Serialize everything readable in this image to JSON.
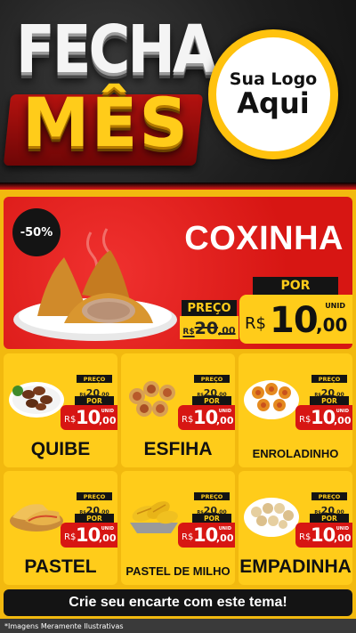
{
  "header": {
    "title_line1": "FECHA",
    "title_line2": "MÊS",
    "logo_line1": "Sua Logo",
    "logo_line2": "Aqui"
  },
  "featured": {
    "discount": "-50%",
    "name": "COXINHA",
    "preco_label": "PREÇO",
    "old_currency": "R$",
    "old_int": "20",
    "old_dec": ",00",
    "por_label": "POR",
    "new_currency": "R$",
    "new_int": "10",
    "new_dec": ",00",
    "unit": "UNID"
  },
  "labels": {
    "preco": "PREÇO",
    "por": "POR",
    "currency": "R$",
    "unit": "UNID"
  },
  "products": [
    {
      "name": "QUIBE",
      "old_int": "20",
      "old_dec": ",00",
      "new_int": "10",
      "new_dec": ",00"
    },
    {
      "name": "ESFIHA",
      "old_int": "20",
      "old_dec": ",00",
      "new_int": "10",
      "new_dec": ",00"
    },
    {
      "name": "ENROLADINHO",
      "old_int": "20",
      "old_dec": ",00",
      "new_int": "10",
      "new_dec": ",00"
    },
    {
      "name": "PASTEL",
      "old_int": "20",
      "old_dec": ",00",
      "new_int": "10",
      "new_dec": ",00"
    },
    {
      "name": "PASTEL DE MILHO",
      "old_int": "20",
      "old_dec": ",00",
      "new_int": "10",
      "new_dec": ",00"
    },
    {
      "name": "EMPADINHA",
      "old_int": "20",
      "old_dec": ",00",
      "new_int": "10",
      "new_dec": ",00"
    }
  ],
  "footer": {
    "cta": "Crie seu encarte com este tema!",
    "disclaimer": "*Imagens Meramente Ilustrativas"
  },
  "colors": {
    "brand_yellow": "#ffcc1a",
    "brand_red": "#d71613",
    "dark": "#141414"
  }
}
